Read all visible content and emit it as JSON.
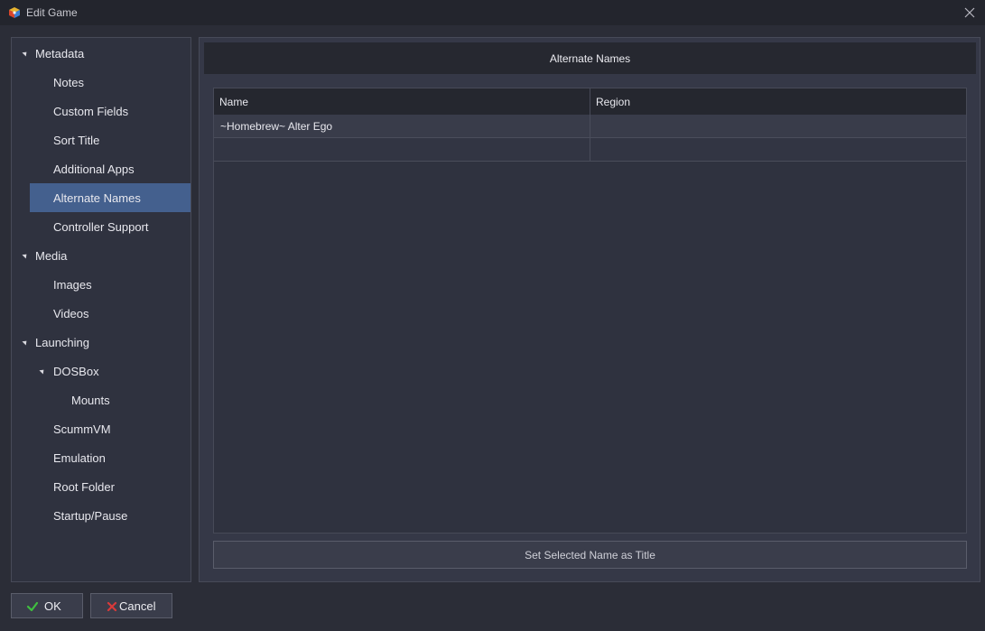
{
  "window": {
    "title": "Edit Game"
  },
  "sidebar": {
    "items": [
      {
        "label": "Metadata",
        "level": 0,
        "expanded": true
      },
      {
        "label": "Notes",
        "level": 1
      },
      {
        "label": "Custom Fields",
        "level": 1
      },
      {
        "label": "Sort Title",
        "level": 1
      },
      {
        "label": "Additional Apps",
        "level": 1
      },
      {
        "label": "Alternate Names",
        "level": 1,
        "selected": true
      },
      {
        "label": "Controller Support",
        "level": 1
      },
      {
        "label": "Media",
        "level": 0,
        "expanded": true
      },
      {
        "label": "Images",
        "level": 1
      },
      {
        "label": "Videos",
        "level": 1
      },
      {
        "label": "Launching",
        "level": 0,
        "expanded": true
      },
      {
        "label": "DOSBox",
        "level": 1,
        "expanded": true
      },
      {
        "label": "Mounts",
        "level": 2
      },
      {
        "label": "ScummVM",
        "level": 1
      },
      {
        "label": "Emulation",
        "level": 1
      },
      {
        "label": "Root Folder",
        "level": 1
      },
      {
        "label": "Startup/Pause",
        "level": 1
      }
    ]
  },
  "main": {
    "header": "Alternate Names",
    "columns": {
      "name": "Name",
      "region": "Region"
    },
    "rows": [
      {
        "name": "~Homebrew~ Alter Ego",
        "region": ""
      },
      {
        "name": "",
        "region": ""
      }
    ],
    "set_button": "Set Selected Name as Title"
  },
  "footer": {
    "ok_label": "OK",
    "cancel_label": "Cancel"
  },
  "colors": {
    "selected": "#44608e",
    "background": "#2b2d37",
    "ok_icon": "#3fbf3f",
    "cancel_icon": "#d83a3a"
  },
  "icons": {
    "app": "launchbox-cube-icon",
    "close": "close-icon",
    "expand": "expanded-triangle-icon",
    "ok": "checkmark-icon",
    "cancel": "x-cancel-icon"
  }
}
